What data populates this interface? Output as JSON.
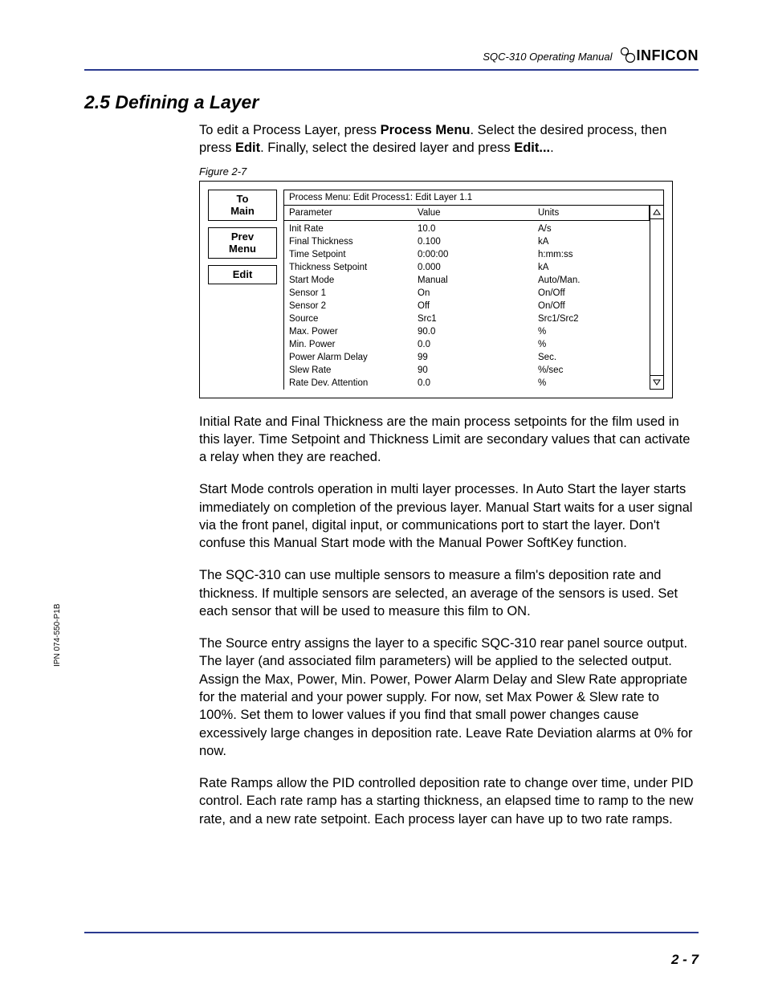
{
  "header": {
    "manual_title": "SQC-310 Operating Manual",
    "logo_text": "INFICON"
  },
  "section": {
    "number_title": "2.5  Defining a Layer"
  },
  "intro": {
    "t1": "To edit a Process Layer, press ",
    "b1": "Process Menu",
    "t2": ". Select the desired process, then press ",
    "b2": "Edit",
    "t3": ". Finally, select the desired layer and press ",
    "b3": "Edit...",
    "t4": "."
  },
  "figure": {
    "caption": "Figure 2-7",
    "breadcrumb": "Process Menu:  Edit Process1:  Edit Layer 1.1",
    "softkeys": [
      "To\nMain",
      "Prev\nMenu",
      "Edit"
    ],
    "columns": {
      "param": "Parameter",
      "value": "Value",
      "units": "Units"
    },
    "rows": [
      {
        "param": "Init Rate",
        "value": "10.0",
        "units": "A/s"
      },
      {
        "param": "Final Thickness",
        "value": "0.100",
        "units": "kA"
      },
      {
        "param": "Time Setpoint",
        "value": "0:00:00",
        "units": "h:mm:ss"
      },
      {
        "param": "Thickness Setpoint",
        "value": "0.000",
        "units": "kA"
      },
      {
        "param": "Start Mode",
        "value": "Manual",
        "units": "Auto/Man."
      },
      {
        "param": "Sensor 1",
        "value": "On",
        "units": "On/Off"
      },
      {
        "param": "Sensor 2",
        "value": "Off",
        "units": "On/Off"
      },
      {
        "param": "Source",
        "value": "Src1",
        "units": "Src1/Src2"
      },
      {
        "param": "Max. Power",
        "value": "90.0",
        "units": "%"
      },
      {
        "param": "Min. Power",
        "value": "0.0",
        "units": "%"
      },
      {
        "param": "Power Alarm Delay",
        "value": "99",
        "units": "Sec."
      },
      {
        "param": "Slew Rate",
        "value": "90",
        "units": "%/sec"
      },
      {
        "param": "Rate Dev. Attention",
        "value": "0.0",
        "units": "%"
      }
    ]
  },
  "paragraphs": {
    "p1": "Initial Rate and Final Thickness are the main process setpoints for the film used in this layer. Time Setpoint and Thickness Limit are secondary values that can activate a relay when they are reached.",
    "p2": "Start Mode controls operation in multi layer processes. In Auto Start the layer starts immediately on completion of the previous layer. Manual Start waits for a user signal via the front panel, digital input, or communications port to start the layer. Don't confuse this Manual Start mode with the Manual Power SoftKey function.",
    "p3": "The SQC-310 can use multiple sensors to measure a film's deposition rate and thickness. If multiple sensors are selected, an average of the sensors is used. Set each sensor that will be used to measure this film to ON.",
    "p4": "The Source entry assigns the layer to a specific SQC-310 rear panel source output. The layer (and associated film parameters) will be applied to the selected output. Assign the Max, Power, Min. Power, Power Alarm Delay and Slew Rate appropriate for the material and your power supply. For now, set Max Power & Slew rate to 100%. Set them to lower values if you find that small power changes cause excessively large changes in deposition rate. Leave Rate Deviation alarms at 0% for now.",
    "p5": "Rate Ramps allow the PID controlled deposition rate to change over time, under PID control. Each rate ramp has a starting thickness, an elapsed time to ramp to the new rate, and a new rate setpoint. Each process layer can have up to two rate ramps."
  },
  "side_text": "IPN 074-550-P1B",
  "page_number": "2 - 7"
}
